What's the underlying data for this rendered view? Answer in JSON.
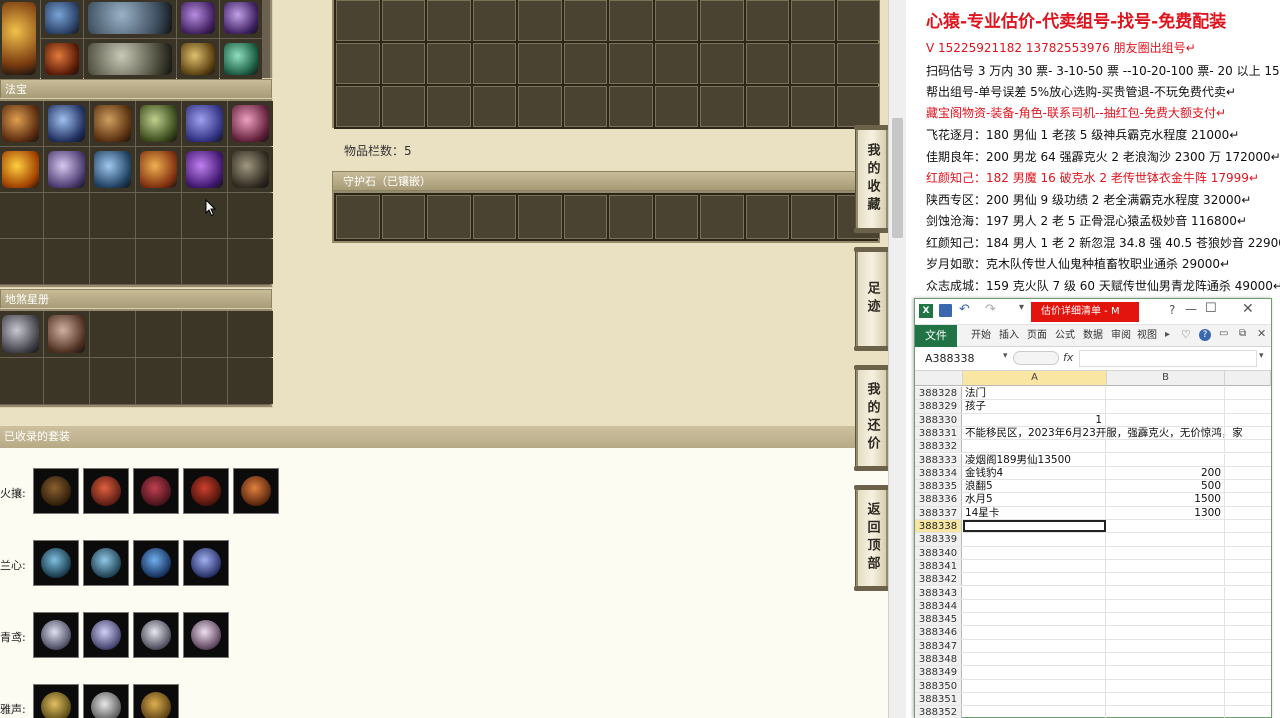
{
  "game": {
    "fabao_title": "法宝",
    "dishaxingce_title": "地煞星册",
    "inventory_count": "物品栏数：5",
    "guardian_title": "守护石（已镶嵌）",
    "suits_title": "已收录的套装",
    "side_tabs": [
      {
        "label": "我的收藏"
      },
      {
        "label": "足迹"
      },
      {
        "label": "我的还价"
      },
      {
        "label": "返回顶部"
      }
    ],
    "suits": [
      {
        "label": "火攘:",
        "count": 5
      },
      {
        "label": "兰心:",
        "count": 4
      },
      {
        "label": "青鸢:",
        "count": 4
      },
      {
        "label": "雅声:",
        "count": 3
      }
    ]
  },
  "notes": {
    "title": "心猿-专业估价-代卖组号-找号-免费配装",
    "lines": [
      {
        "text": "V 15225921182   13782553976 朋友圈出组号↵",
        "red": true
      },
      {
        "text": "扫码估号 3 万内 30 票- 3-10-50 票  --10-20-100 票- 20 以上 150↵",
        "red": false
      },
      {
        "text": "帮出组号-单号误差 5%放心选购-买贵管退-不玩免费代卖↵",
        "red": false
      },
      {
        "text": "藏宝阁物资-装备-角色-联系司机--抽红包-免费大额支付↵",
        "red": true
      },
      {
        "text": "飞花逐月：180 男仙 1 老孩 5 级神兵霸克水程度 21000↵",
        "red": false
      },
      {
        "text": "佳期良年：200 男龙 64 强霹克火 2 老浪淘沙 2300 万 172000↵",
        "red": false
      },
      {
        "text": "红颜知己：182 男魔 16 破克水 2 老传世钵衣金牛阵 17999↵",
        "red": true
      },
      {
        "text": "陕西专区：200 男仙 9 级功绩 2 老全满霸克水程度 32000↵",
        "red": false
      },
      {
        "text": "剑蚀沧海：197 男人 2 老 5 正骨混心猿孟极妙音 116800↵",
        "red": false
      },
      {
        "text": "红颜知己：184 男人 1 老 2 新忽混 34.8 强 40.5 苍狼妙音 22900↵",
        "red": false
      },
      {
        "text": "岁月如歌：克木队传世人仙鬼种植畜牧职业通杀 29000↵",
        "red": false
      },
      {
        "text": "众志成城：159 克火队 7 级 60 天赋传世仙男青龙阵通杀 49000↵",
        "red": false
      }
    ]
  },
  "excel": {
    "title": "估价详细清单 - M",
    "tabs": [
      "文件",
      "开始",
      "插入",
      "页面",
      "公式",
      "数据",
      "审阅",
      "视图"
    ],
    "name_box": "A388338",
    "fx": "fx",
    "col_a": "A",
    "col_b": "B",
    "rows": [
      {
        "n": "388328",
        "a": "法门",
        "b": ""
      },
      {
        "n": "388329",
        "a": "孩子",
        "b": ""
      },
      {
        "n": "388330",
        "a": "1",
        "b": "",
        "anum": true
      },
      {
        "n": "388331",
        "a": "不能移民区，2023年6月23开服，强霹克火，无价惊鸿，家",
        "b": ""
      },
      {
        "n": "388332",
        "a": "",
        "b": ""
      },
      {
        "n": "388333",
        "a": "凌烟阁189男仙13500",
        "b": ""
      },
      {
        "n": "388334",
        "a": "金钱豹4",
        "b": "200"
      },
      {
        "n": "388335",
        "a": "浪翻5",
        "b": "500"
      },
      {
        "n": "388336",
        "a": "水月5",
        "b": "1500"
      },
      {
        "n": "388337",
        "a": "14星卡",
        "b": "1300"
      },
      {
        "n": "388338",
        "a": "",
        "b": "",
        "sel": true
      },
      {
        "n": "388339",
        "a": "",
        "b": ""
      },
      {
        "n": "388340",
        "a": "",
        "b": ""
      },
      {
        "n": "388341",
        "a": "",
        "b": ""
      },
      {
        "n": "388342",
        "a": "",
        "b": ""
      },
      {
        "n": "388343",
        "a": "",
        "b": ""
      },
      {
        "n": "388344",
        "a": "",
        "b": ""
      },
      {
        "n": "388345",
        "a": "",
        "b": ""
      },
      {
        "n": "388346",
        "a": "",
        "b": ""
      },
      {
        "n": "388347",
        "a": "",
        "b": ""
      },
      {
        "n": "388348",
        "a": "",
        "b": ""
      },
      {
        "n": "388349",
        "a": "",
        "b": ""
      },
      {
        "n": "388350",
        "a": "",
        "b": ""
      },
      {
        "n": "388351",
        "a": "",
        "b": ""
      },
      {
        "n": "388352",
        "a": "",
        "b": ""
      }
    ]
  },
  "colors": {
    "red": "#e0141e",
    "excel_green": "#217346"
  }
}
